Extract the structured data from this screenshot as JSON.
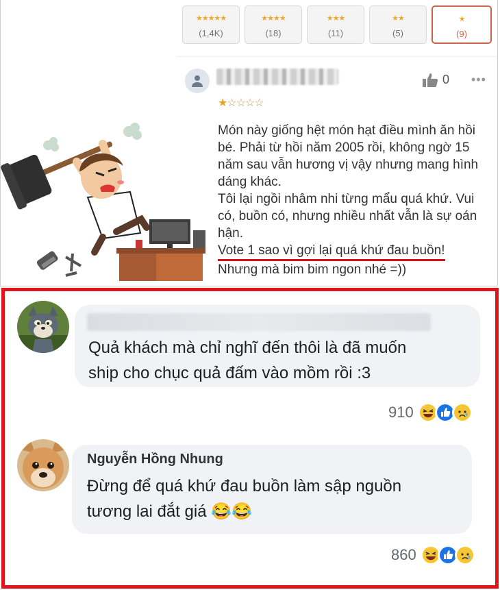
{
  "rating_filters": [
    {
      "stars": "★★★★★",
      "count": "(1,4K)"
    },
    {
      "stars": "★★★★",
      "count": "(18)"
    },
    {
      "stars": "★★★",
      "count": "(11)"
    },
    {
      "stars": "★★",
      "count": "(5)"
    },
    {
      "stars": "★",
      "count": "(9)",
      "selected": true
    }
  ],
  "review": {
    "likes": "0",
    "more": "•••",
    "stars_on": "★",
    "stars_off": "☆☆☆☆",
    "rating": 1,
    "lines": [
      "Món này giống hệt món hạt điều mình ăn hồi bé. Phải từ hồi năm 2005 rồi, không ngờ 15 năm sau vẫn hương vị vậy nhưng mang hình dáng khác.",
      "Tôi lại ngồi nhâm nhi từng mẩu quá khứ. Vui có, buồn có, nhưng nhiều nhất vẫn là sự oán hận."
    ],
    "underlined": "Vote 1 sao vì gợi lại quá khứ đau buồn!",
    "last": "Nhưng mà bim bim ngon nhé =))"
  },
  "comments": [
    {
      "name": "",
      "text_line1": "Quả khách mà chỉ nghĩ đến thôi là đã muốn",
      "text_line2": "ship cho chục quả đấm vào mồm rồi :3",
      "reactions": "910"
    },
    {
      "name": "Nguyễn Hồng Nhung",
      "text_line1": "Đừng để quá khứ đau buồn làm sập nguồn",
      "text_line2": "tương lai đắt giá",
      "emoji": "😂😂",
      "reactions": "860"
    }
  ],
  "colors": {
    "highlight_border": "#e0141b",
    "star": "#f0a92a",
    "selected_filter": "#c8664b"
  }
}
